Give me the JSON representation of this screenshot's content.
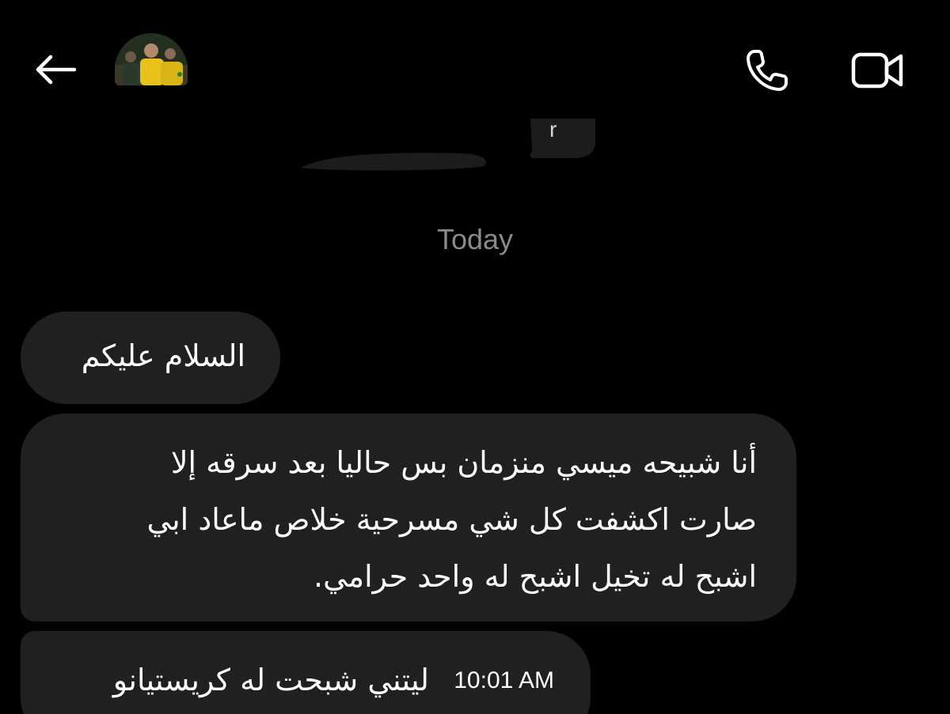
{
  "header": {
    "back_icon": "arrow-left-icon",
    "avatar": "contact-avatar",
    "call_icon": "phone-icon",
    "video_icon": "video-camera-icon"
  },
  "previous_message": {
    "visible_fragment": "r"
  },
  "date_divider": "Today",
  "messages": [
    {
      "lines": [
        "السلام عليكم"
      ]
    },
    {
      "lines": [
        "أنا شبيحه ميسي منزمان بس حاليا بعد سرقه إلا",
        "صارت اكشفت كل شي مسرحية خلاص ماعاد ابي",
        "اشبح له تخيل اشبح له واحد حرامي."
      ]
    },
    {
      "lines": [
        "ليتني شبحت له كريستيانو"
      ],
      "time": "10:01 AM"
    }
  ],
  "colors": {
    "background": "#000000",
    "bubble": "#1f2022",
    "text": "#ffffff",
    "muted": "#8a8a8e"
  }
}
